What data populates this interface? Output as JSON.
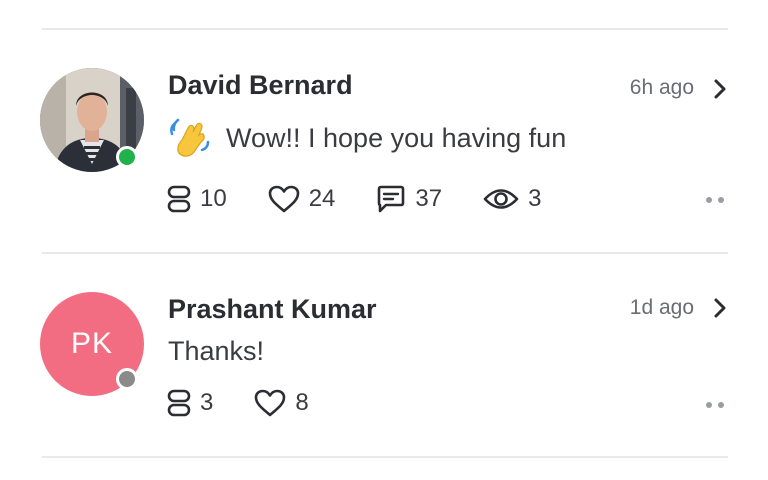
{
  "comments": [
    {
      "name": "David Bernard",
      "time": "6h ago",
      "emoji": "waving-hand",
      "message": "Wow!! I hope you having fun",
      "status": "online",
      "stats": {
        "threads": "10",
        "likes": "24",
        "comments": "37",
        "views": "3"
      }
    },
    {
      "name": "Prashant Kumar",
      "initials": "PK",
      "time": "1d ago",
      "message": "Thanks!",
      "status": "offline",
      "stats": {
        "threads": "3",
        "likes": "8"
      }
    }
  ],
  "colors": {
    "initials_avatar": "#f36d82",
    "online": "#22b24c",
    "offline": "#8a8a8a",
    "divider": "#e9e9ec"
  }
}
